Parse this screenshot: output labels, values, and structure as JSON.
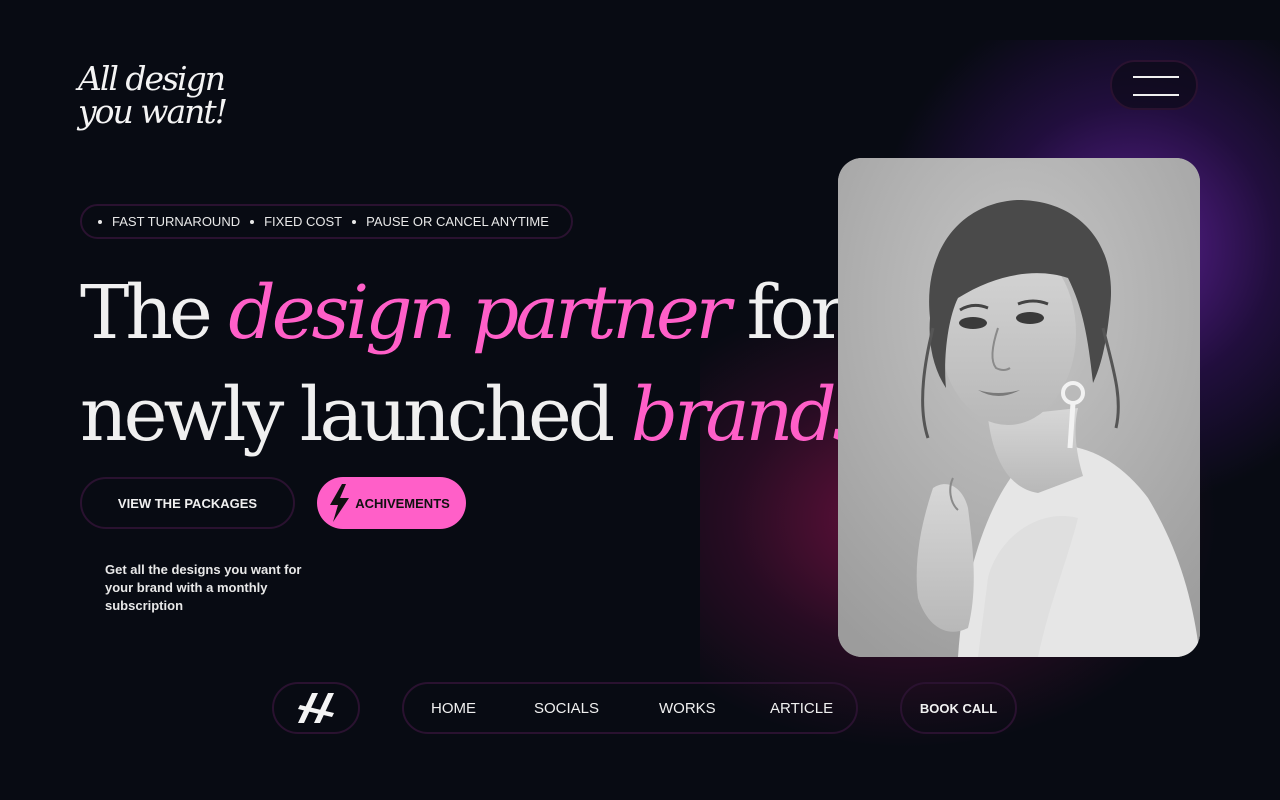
{
  "logo": {
    "line1": "All design",
    "line2": "you want!"
  },
  "menu": {
    "icon": "hamburger-icon"
  },
  "tagline": {
    "items": [
      "FAST TURNAROUND",
      "FIXED COST",
      "PAUSE OR CANCEL ANYTIME"
    ]
  },
  "headline": {
    "word1": "The",
    "accent1": "design partner",
    "word2": "for",
    "line2_plain": "newly launched",
    "accent2": "brands."
  },
  "buttons": {
    "packages": "VIEW THE PACKAGES",
    "achievements": "ACHIVEMENTS",
    "achievements_icon": "lightning-bolt-icon",
    "book_call": "BOOK CALL"
  },
  "description": "Get all the designs you want for your brand with a monthly subscription",
  "nav": {
    "logo_icon": "brand-mark-icon",
    "items": [
      "HOME",
      "SOCIALS",
      "WORKS",
      "ARTICLE"
    ]
  },
  "colors": {
    "accent": "#ff5fc8",
    "background": "#080b13",
    "border": "#2a1230"
  }
}
